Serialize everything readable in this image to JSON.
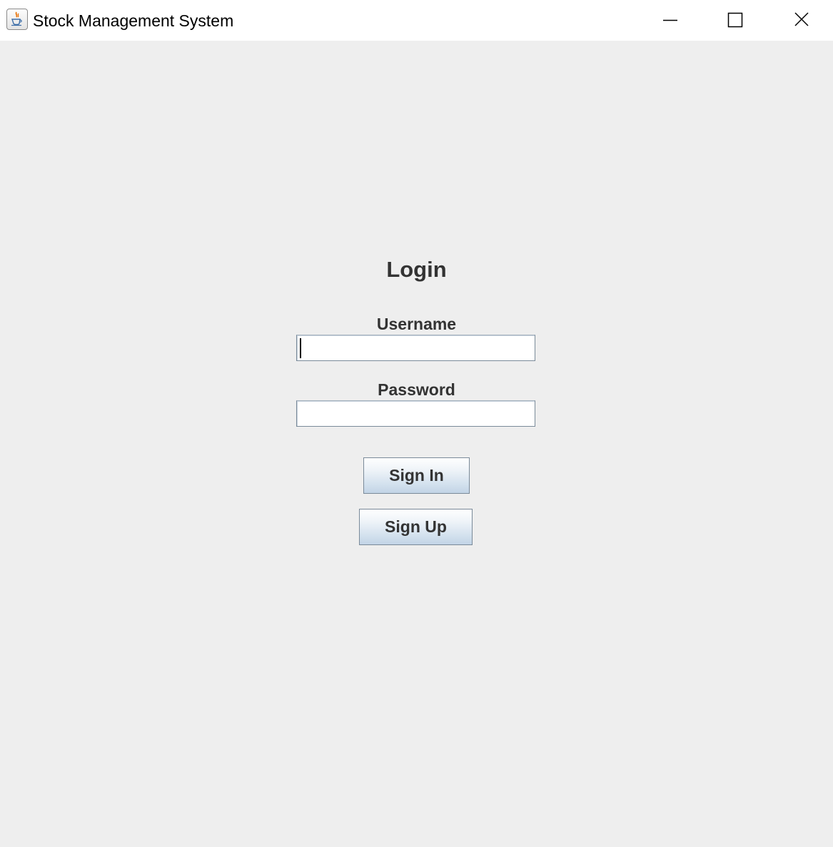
{
  "window": {
    "title": "Stock Management System",
    "app_icon": "java-coffee-cup-icon",
    "controls": [
      "minimize-icon",
      "maximize-icon",
      "close-icon"
    ]
  },
  "login": {
    "heading": "Login",
    "username_label": "Username",
    "username_value": "",
    "password_label": "Password",
    "password_value": "",
    "sign_in_label": "Sign In",
    "sign_up_label": "Sign Up"
  },
  "colors": {
    "background": "#eeeeee",
    "titlebar": "#ffffff",
    "text": "#333333",
    "button_gradient_bottom": "#c2d4e6",
    "border": "#7a8a99"
  }
}
